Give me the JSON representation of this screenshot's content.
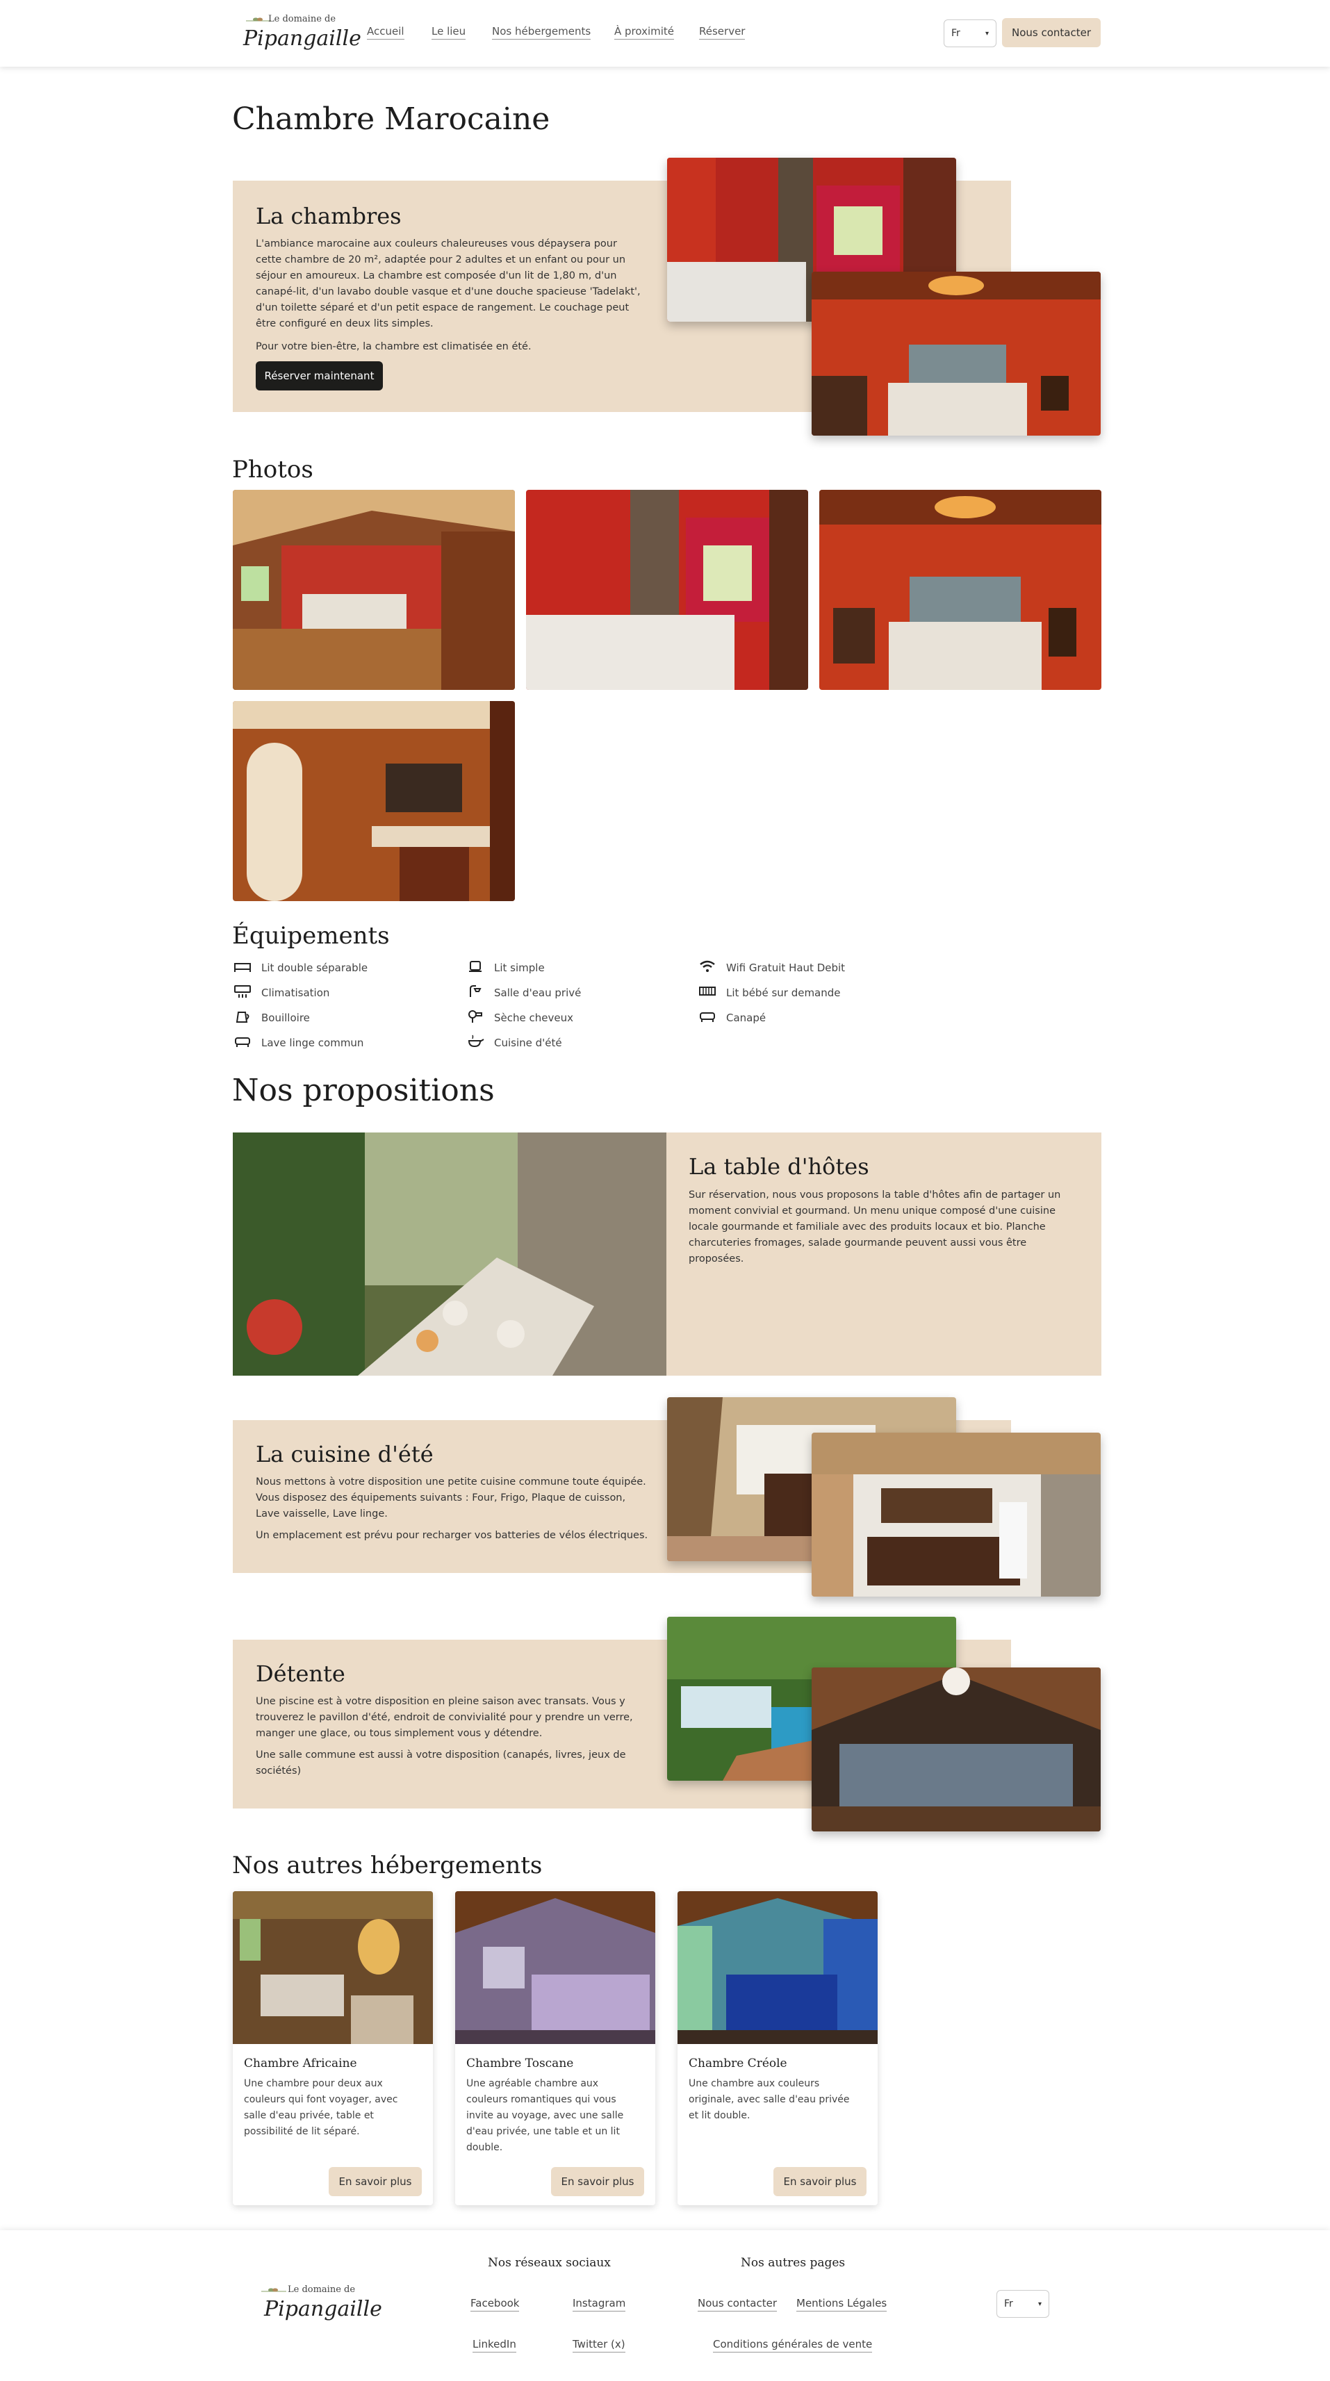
{
  "header": {
    "logo_small": "Le domaine de",
    "logo_big": "Pipangaille",
    "nav": [
      "Accueil",
      "Le lieu",
      "Nos hébergements",
      "À proximité",
      "Réserver"
    ],
    "lang": "Fr",
    "contact_button": "Nous contacter"
  },
  "page": {
    "title": "Chambre Marocaine"
  },
  "intro": {
    "title": "La chambres",
    "text1": "L'ambiance marocaine aux couleurs chaleureuses vous dépaysera pour cette chambre de 20 m², adaptée pour 2 adultes et un enfant ou pour un séjour en amoureux. La chambre est composée d'un lit de 1,80 m, d'un canapé-lit, d'un lavabo double vasque et d'une douche spacieuse 'Tadelakt', d'un toilette séparé et d'un petit espace de rangement. Le couchage peut être configuré en deux lits simples.",
    "text2": "Pour votre bien-être, la chambre est climatisée en été.",
    "button": "Réserver maintenant"
  },
  "photos": {
    "title": "Photos"
  },
  "equipements": {
    "title": "Équipements",
    "items": [
      {
        "label": "Lit double séparable",
        "icon": "double-bed-icon"
      },
      {
        "label": "Lit simple",
        "icon": "single-bed-icon"
      },
      {
        "label": "Wifi Gratuit Haut Debit",
        "icon": "wifi-icon"
      },
      {
        "label": "Climatisation",
        "icon": "air-conditioning-icon"
      },
      {
        "label": "Salle d'eau privé",
        "icon": "shower-icon"
      },
      {
        "label": "Lit bébé sur demande",
        "icon": "baby-bed-icon"
      },
      {
        "label": "Bouilloire",
        "icon": "kettle-icon"
      },
      {
        "label": "Sèche cheveux",
        "icon": "hair-dryer-icon"
      },
      {
        "label": "Canapé",
        "icon": "sofa-icon"
      },
      {
        "label": "Lave linge commun",
        "icon": "washing-machine-icon"
      },
      {
        "label": "Cuisine d'été",
        "icon": "cooking-pot-icon"
      }
    ]
  },
  "propositions": {
    "title": "Nos propositions",
    "table": {
      "title": "La table d'hôtes",
      "text": "Sur réservation, nous vous proposons la table d'hôtes afin de partager un moment convivial et gourmand. Un menu unique composé d'une cuisine locale gourmande et familiale avec des produits locaux et bio. Planche charcuteries fromages, salade gourmande peuvent aussi vous être proposées."
    },
    "cuisine": {
      "title": "La cuisine d'été",
      "text1": "Nous mettons à votre disposition une petite cuisine commune toute équipée. Vous disposez des équipements suivants : Four, Frigo, Plaque de cuisson, Lave vaisselle, Lave linge.",
      "text2": "Un emplacement est prévu pour recharger vos batteries de vélos électriques."
    },
    "detente": {
      "title": "Détente",
      "text1": "Une piscine est à votre disposition en pleine saison avec transats. Vous y trouverez le pavillon d'été, endroit de convivialité pour y prendre un verre, manger une glace, ou tous simplement vous y détendre.",
      "text2": "Une salle commune est aussi à votre disposition (canapés, livres, jeux de sociétés)"
    }
  },
  "autres": {
    "title": "Nos autres hébergements",
    "cards": [
      {
        "title": "Chambre Africaine",
        "text": "Une chambre pour deux aux couleurs qui font voyager, avec salle d'eau privée, table et possibilité de lit séparé.",
        "button": "En savoir plus"
      },
      {
        "title": "Chambre Toscane",
        "text": "Une agréable chambre aux couleurs romantiques qui vous invite au voyage, avec une salle d'eau privée, une table et un lit double.",
        "button": "En savoir plus"
      },
      {
        "title": "Chambre Créole",
        "text": "Une chambre aux couleurs originale, avec salle d'eau privée et lit double.",
        "button": "En savoir plus"
      }
    ]
  },
  "footer": {
    "logo_small": "Le domaine de",
    "logo_big": "Pipangaille",
    "social_title": "Nos réseaux sociaux",
    "social": [
      "Facebook",
      "Instagram",
      "LinkedIn",
      "Twitter (x)"
    ],
    "pages_title": "Nos autres pages",
    "pages": [
      "Nous contacter",
      "Mentions Légales",
      "Conditions générales de vente"
    ],
    "lang": "Fr"
  }
}
